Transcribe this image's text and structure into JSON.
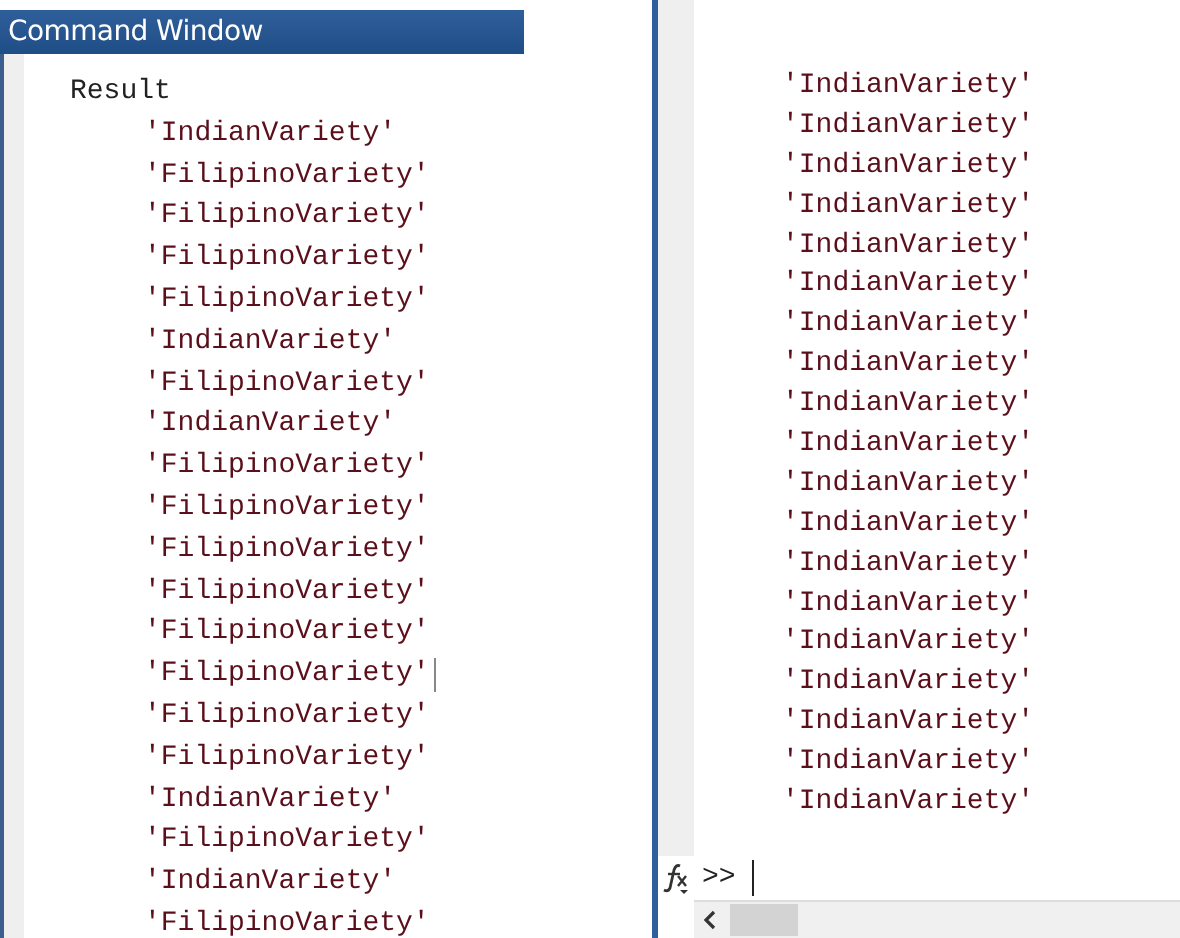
{
  "left_panel": {
    "title": "Command Window",
    "variable_name": "Result",
    "lines": [
      "'IndianVariety'",
      "'FilipinoVariety'",
      "'FilipinoVariety'",
      "'FilipinoVariety'",
      "'FilipinoVariety'",
      "'IndianVariety'",
      "'FilipinoVariety'",
      "'IndianVariety'",
      "'FilipinoVariety'",
      "'FilipinoVariety'",
      "'FilipinoVariety'",
      "'FilipinoVariety'",
      "'FilipinoVariety'",
      "'FilipinoVariety'",
      "'FilipinoVariety'",
      "'FilipinoVariety'",
      "'IndianVariety'",
      "'FilipinoVariety'",
      "'IndianVariety'",
      "'FilipinoVariety'"
    ]
  },
  "right_panel": {
    "lines": [
      "'IndianVariety'",
      "'IndianVariety'",
      "'IndianVariety'",
      "'IndianVariety'",
      "'IndianVariety'",
      "'IndianVariety'",
      "'IndianVariety'",
      "'IndianVariety'",
      "'IndianVariety'",
      "'IndianVariety'",
      "'IndianVariety'",
      "'IndianVariety'",
      "'IndianVariety'",
      "'IndianVariety'",
      "'IndianVariety'",
      "'IndianVariety'",
      "'IndianVariety'",
      "'IndianVariety'",
      "'IndianVariety'"
    ],
    "prompt": ">>"
  }
}
